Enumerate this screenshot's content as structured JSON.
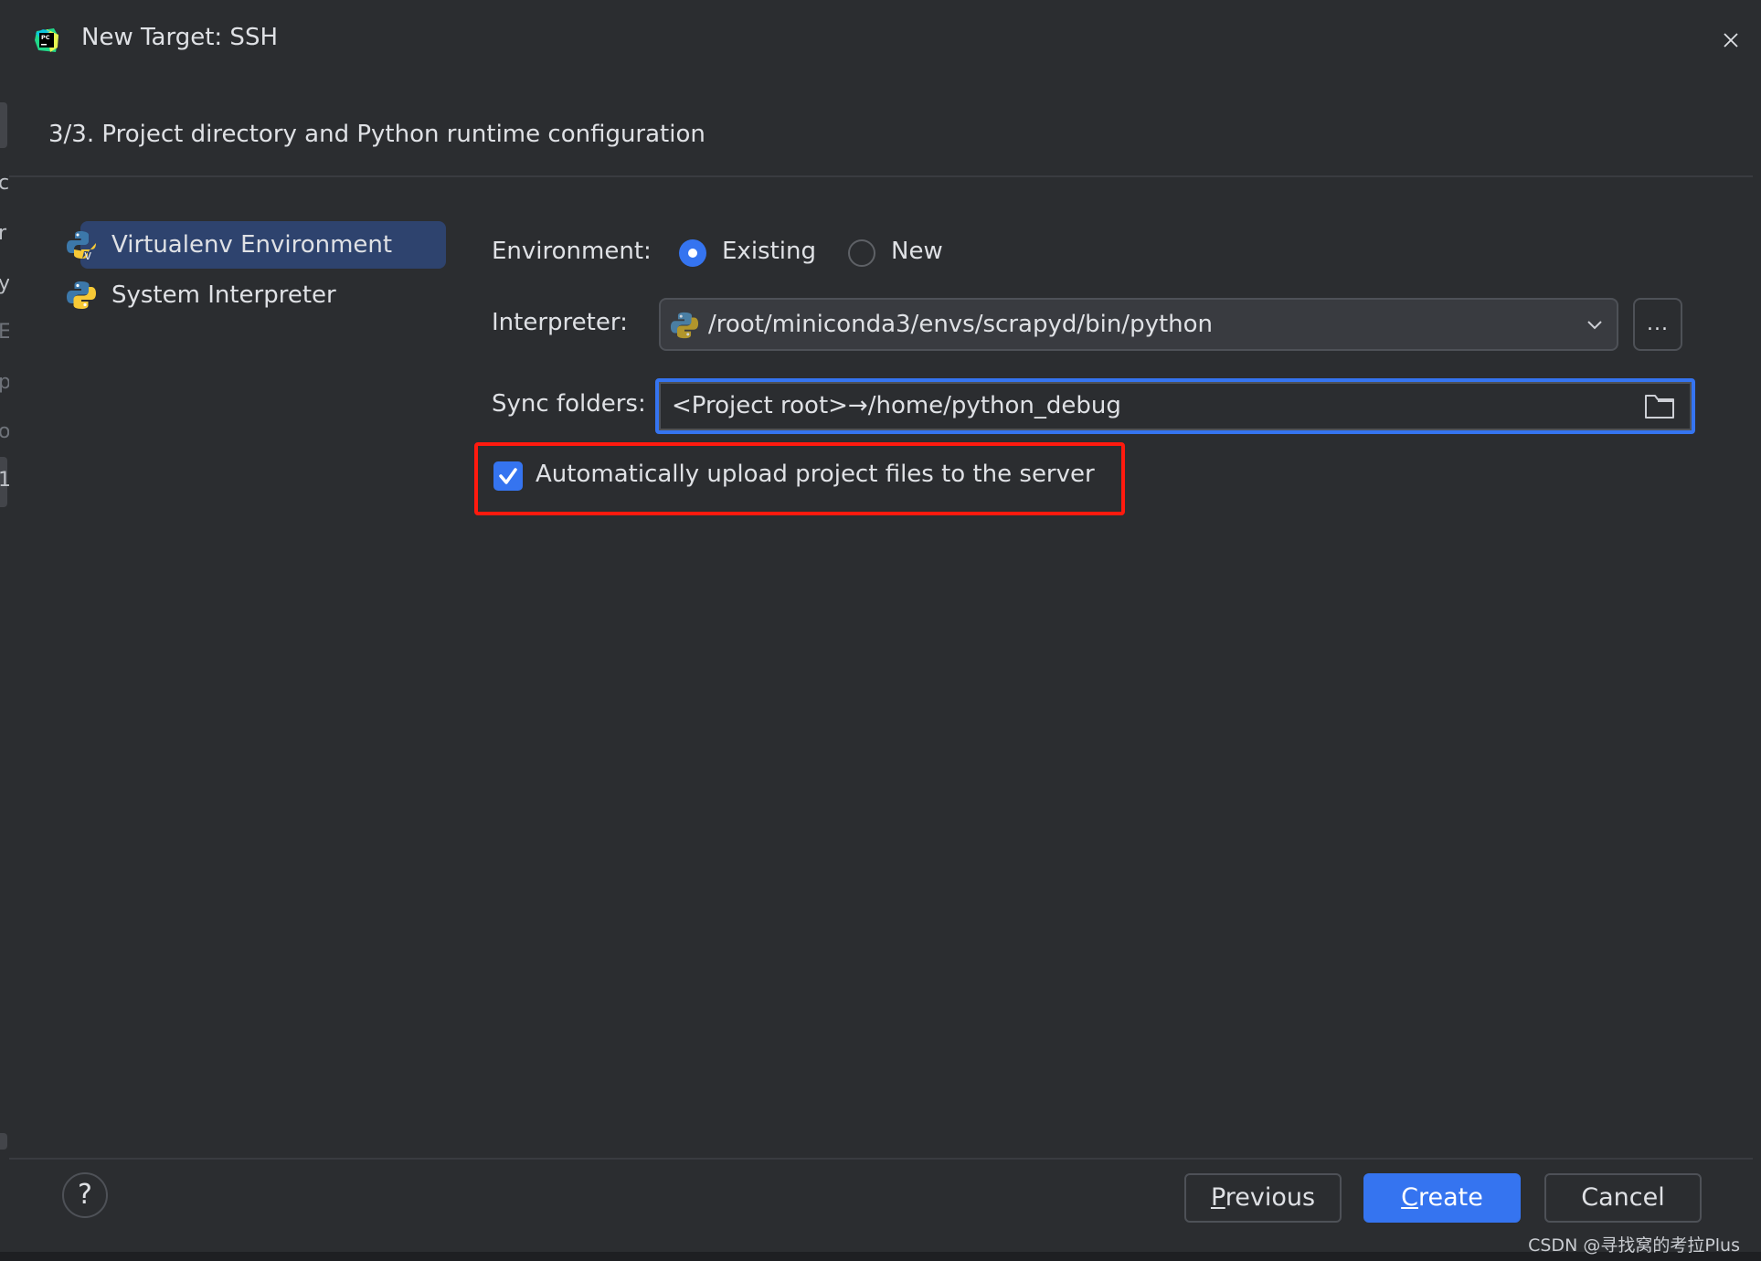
{
  "dialog": {
    "title": "New Target: SSH",
    "step_title": "3/3. Project directory and Python runtime configuration"
  },
  "sidebar": {
    "items": [
      {
        "label": "Virtualenv Environment",
        "icon": "python-virtualenv-icon",
        "selected": true
      },
      {
        "label": "System Interpreter",
        "icon": "python-icon",
        "selected": false
      }
    ]
  },
  "form": {
    "environment": {
      "label": "Environment:",
      "options": [
        {
          "label": "Existing",
          "selected": true
        },
        {
          "label": "New",
          "selected": false
        }
      ]
    },
    "interpreter": {
      "label": "Interpreter:",
      "value": "/root/miniconda3/envs/scrapyd/bin/python",
      "browse_label": "..."
    },
    "sync_folders": {
      "label": "Sync folders:",
      "value": "<Project root>→/home/python_debug"
    },
    "auto_upload": {
      "label": "Automatically upload project files to the server",
      "checked": true
    }
  },
  "footer": {
    "help_label": "?",
    "previous": {
      "mnemonic": "P",
      "rest": "revious"
    },
    "create": {
      "mnemonic": "C",
      "rest": "reate"
    },
    "cancel_label": "Cancel"
  },
  "background_strip_chars": [
    "c",
    "r",
    "y",
    "E",
    "p",
    "o",
    "1"
  ],
  "watermark": "CSDN @寻找窝的考拉Plus",
  "colors": {
    "accent": "#3574f0",
    "highlight_box": "#ff1a0e",
    "selection": "#2e436e",
    "background": "#2b2d30"
  }
}
